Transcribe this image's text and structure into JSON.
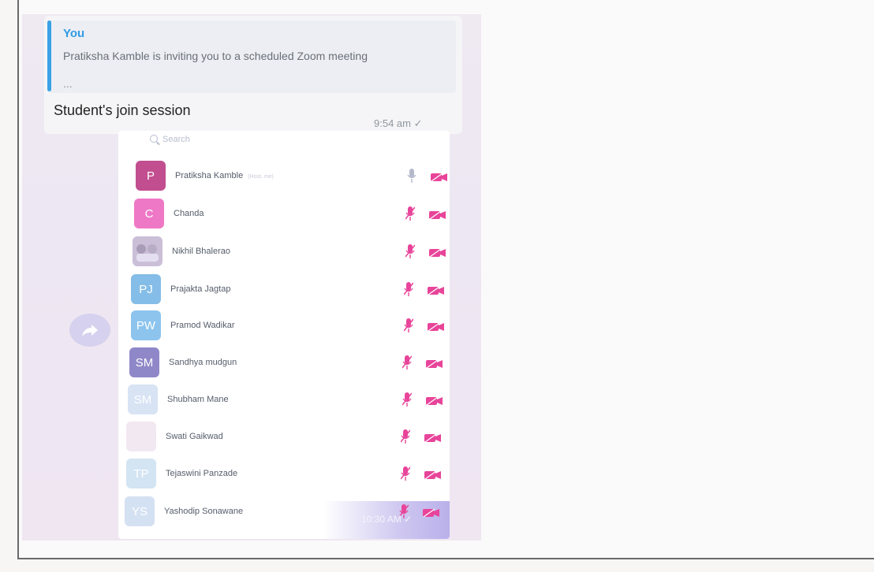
{
  "message": {
    "quote_sender": "You",
    "quote_text": "Pratiksha Kamble is inviting you to a scheduled Zoom meeting",
    "quote_ellipsis": "...",
    "text": "Student's join session",
    "time": "9:54 am ✓"
  },
  "zoom": {
    "search_placeholder": "Search",
    "host_tag": "(Host, me)",
    "participants": [
      {
        "initials": "P",
        "name": "Pratiksha Kamble",
        "avatar_color": "#c24e8f",
        "mic_muted": false
      },
      {
        "initials": "C",
        "name": "Chanda",
        "avatar_color": "#ee78c6",
        "mic_muted": true
      },
      {
        "initials": "",
        "name": "Nikhil Bhalerao",
        "avatar_color": "#cbbfd8",
        "mic_muted": true
      },
      {
        "initials": "PJ",
        "name": "Prajakta Jagtap",
        "avatar_color": "#84bde7",
        "mic_muted": true
      },
      {
        "initials": "PW",
        "name": "Pramod Wadikar",
        "avatar_color": "#8cc4ee",
        "mic_muted": true
      },
      {
        "initials": "SM",
        "name": "Sandhya mudgun",
        "avatar_color": "#8f88c8",
        "mic_muted": true
      },
      {
        "initials": "SM",
        "name": "Shubham Mane",
        "avatar_color": "#d8e3f4",
        "mic_muted": true
      },
      {
        "initials": "",
        "name": "Swati Gaikwad",
        "avatar_color": "#f2e8f1",
        "mic_muted": true
      },
      {
        "initials": "TP",
        "name": "Tejaswini Panzade",
        "avatar_color": "#d3e4f3",
        "mic_muted": true
      },
      {
        "initials": "YS",
        "name": "Yashodip Sonawane",
        "avatar_color": "#d4e1f2",
        "mic_muted": true
      }
    ],
    "overlay_time": "10:30 AM ✓"
  },
  "colors": {
    "accent_blue": "#3aa1e6",
    "icon_pink": "#e8449a",
    "icon_grey": "#b5b9cc"
  }
}
